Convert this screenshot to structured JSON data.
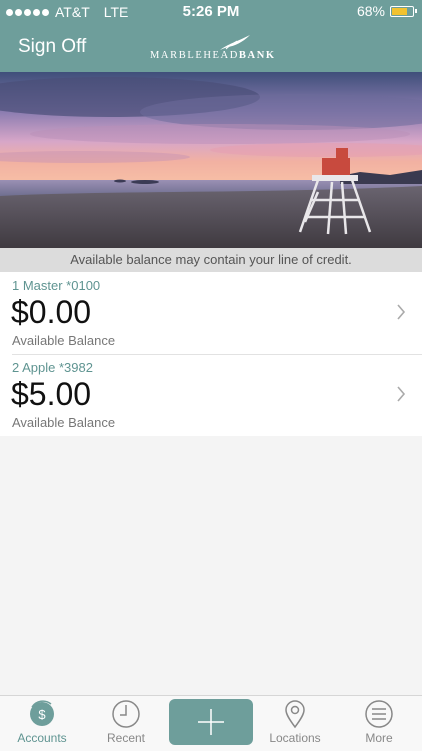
{
  "status": {
    "carrier": "AT&T",
    "network": "LTE",
    "time": "5:26 PM",
    "battery": "68%"
  },
  "nav": {
    "sign_off": "Sign Off",
    "brand_a": "MARBLEHEAD",
    "brand_b": "BANK"
  },
  "notice": "Available balance may contain your line of credit.",
  "accounts": [
    {
      "name": "1 Master *0100",
      "balance": "$0.00",
      "label": "Available Balance"
    },
    {
      "name": "2 Apple *3982",
      "balance": "$5.00",
      "label": "Available Balance"
    }
  ],
  "tabs": {
    "accounts": "Accounts",
    "recent": "Recent",
    "locations": "Locations",
    "more": "More"
  },
  "colors": {
    "brand": "#6e9e9b",
    "accent_text": "#5f9491",
    "battery": "#f2c230"
  }
}
